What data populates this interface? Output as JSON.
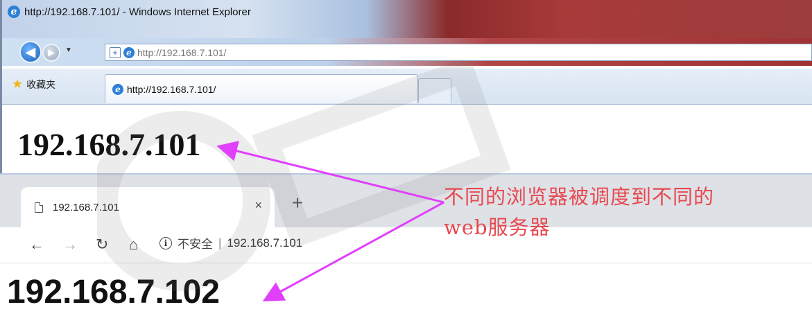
{
  "ie": {
    "title": "http://192.168.7.101/ - Windows Internet Explorer",
    "address": "http://192.168.7.101/",
    "favorites_label": "收藏夹",
    "tab_title": "http://192.168.7.101/",
    "page_text": "192.168.7.101"
  },
  "chrome": {
    "tab_title": "192.168.7.101",
    "close_glyph": "×",
    "new_tab_glyph": "+",
    "insecure_label": "不安全",
    "url": "192.168.7.101",
    "page_text": "192.168.7.102"
  },
  "annotation": {
    "line1": "不同的浏览器被调度到不同的",
    "line2": "web服务器",
    "color": "#e8484f",
    "arrow_color": "#e040fb"
  },
  "icons": {
    "back": "back-arrow-icon",
    "forward": "forward-arrow-icon",
    "reload": "reload-icon",
    "home": "home-icon",
    "info": "info-icon",
    "favorites": "star-icon",
    "page": "page-icon"
  }
}
